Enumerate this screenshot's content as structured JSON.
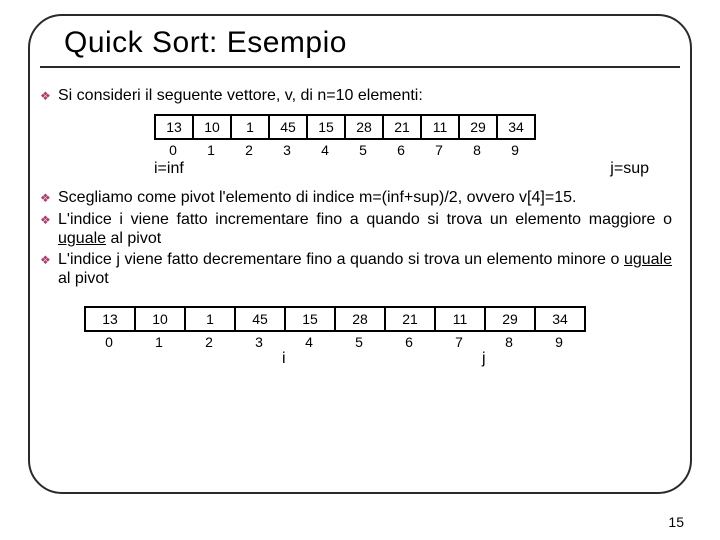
{
  "title": "Quick Sort: Esempio",
  "bullets": {
    "b0": "Si consideri il seguente vettore, v, di n=10 elementi:",
    "b1_pre": "Scegliamo come pivot l'elemento di indice m=(inf+sup)/2, ovvero v[4]=15.",
    "b2_pre": "L'indice i viene fatto incrementare fino a quando si trova un elemento maggiore o ",
    "b2_u": "uguale",
    "b2_post": " al pivot",
    "b3_pre": "L'indice j viene fatto decrementare fino a quando si trova un elemento minore o ",
    "b3_u": "uguale",
    "b3_post": " al pivot"
  },
  "vec1": {
    "v": [
      "13",
      "10",
      "1",
      "45",
      "15",
      "28",
      "21",
      "11",
      "29",
      "34"
    ],
    "idx": [
      "0",
      "1",
      "2",
      "3",
      "4",
      "5",
      "6",
      "7",
      "8",
      "9"
    ]
  },
  "annot1": {
    "left": "i=inf",
    "right": "j=sup"
  },
  "vec2": {
    "v": [
      "13",
      "10",
      "1",
      "45",
      "15",
      "28",
      "21",
      "11",
      "29",
      "34"
    ],
    "idx": [
      "0",
      "1",
      "2",
      "3",
      "4",
      "5",
      "6",
      "7",
      "8",
      "9"
    ]
  },
  "annot2": {
    "i": "i",
    "j": "j"
  },
  "pagenum": "15",
  "bullet_glyph": "❖"
}
